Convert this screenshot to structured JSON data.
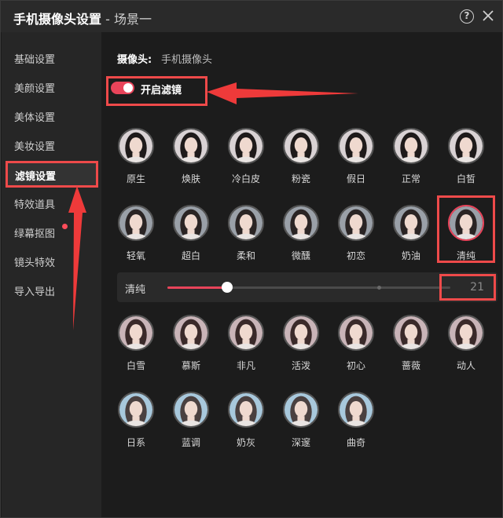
{
  "title": {
    "main": "手机摄像头设置",
    "sub": " - 场景一"
  },
  "sidebar": {
    "items": [
      {
        "label": "基础设置"
      },
      {
        "label": "美颜设置"
      },
      {
        "label": "美体设置"
      },
      {
        "label": "美妆设置"
      },
      {
        "label": "滤镜设置",
        "active": true
      },
      {
        "label": "特效道具"
      },
      {
        "label": "绿幕抠图",
        "dot": true
      },
      {
        "label": "镜头特效"
      },
      {
        "label": "导入导出"
      }
    ]
  },
  "camera": {
    "label": "摄像头:",
    "value": "手机摄像头"
  },
  "filter_toggle": {
    "label": "开启滤镜",
    "on": true
  },
  "filters_row1": [
    "原生",
    "焕肤",
    "冷白皮",
    "粉瓷",
    "假日",
    "正常",
    "白皙"
  ],
  "filters_row2": [
    "轻氧",
    "超白",
    "柔和",
    "微醺",
    "初恋",
    "奶油",
    "清纯"
  ],
  "filters_row3": [
    "白雪",
    "慕斯",
    "非凡",
    "活泼",
    "初心",
    "蔷薇",
    "动人"
  ],
  "filters_row4": [
    "日系",
    "蓝调",
    "奶灰",
    "深邃",
    "曲奇"
  ],
  "selected_filter": "清纯",
  "slider": {
    "label": "清纯",
    "value": "21",
    "fraction": 0.21
  },
  "colors": {
    "accent": "#e8445a",
    "highlight_box": "#ee4a4a"
  }
}
